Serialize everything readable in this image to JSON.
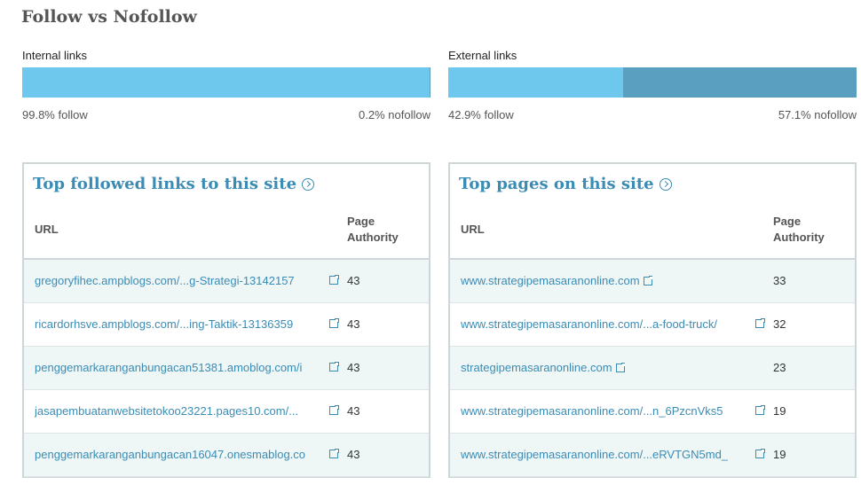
{
  "title": "Follow vs Nofollow",
  "internal": {
    "label": "Internal links",
    "follow_pct": 99.8,
    "follow_text": "99.8% follow",
    "nofollow_text": "0.2% nofollow"
  },
  "external": {
    "label": "External links",
    "follow_pct": 42.9,
    "follow_text": "42.9% follow",
    "nofollow_text": "57.1% nofollow"
  },
  "colors": {
    "follow": "#6ec7ec",
    "nofollow": "#5a9fbf",
    "link": "#3b8cb5"
  },
  "panels": [
    {
      "title": "Top followed links to this site",
      "col_url": "URL",
      "col_pa_1": "Page",
      "col_pa_2": "Authority",
      "url_width": 320,
      "rows": [
        {
          "url": "gregoryfihec.ampblogs.com/...g-Strategi-13142157",
          "pa": "43"
        },
        {
          "url": "ricardorhsve.ampblogs.com/...ing-Taktik-13136359",
          "pa": "43"
        },
        {
          "url": "penggemarkaranganbungacan51381.amoblog.com/i",
          "pa": "43"
        },
        {
          "url": "jasapembuatanwebsitetokoo23221.pages10.com/...",
          "pa": "43"
        },
        {
          "url": "penggemarkaranganbungacan16047.onesmablog.co",
          "pa": "43"
        }
      ]
    },
    {
      "title": "Top pages on this site",
      "col_url": "URL",
      "col_pa_1": "Page",
      "col_pa_2": "Authority",
      "url_width": 340,
      "rows": [
        {
          "url": "www.strategipemasaranonline.com",
          "pa": "33"
        },
        {
          "url": "www.strategipemasaranonline.com/...a-food-truck/",
          "pa": "32"
        },
        {
          "url": "strategipemasaranonline.com",
          "pa": "23"
        },
        {
          "url": "www.strategipemasaranonline.com/...n_6PzcnVks5",
          "pa": "19"
        },
        {
          "url": "www.strategipemasaranonline.com/...eRVTGN5md_",
          "pa": "19"
        }
      ]
    }
  ]
}
